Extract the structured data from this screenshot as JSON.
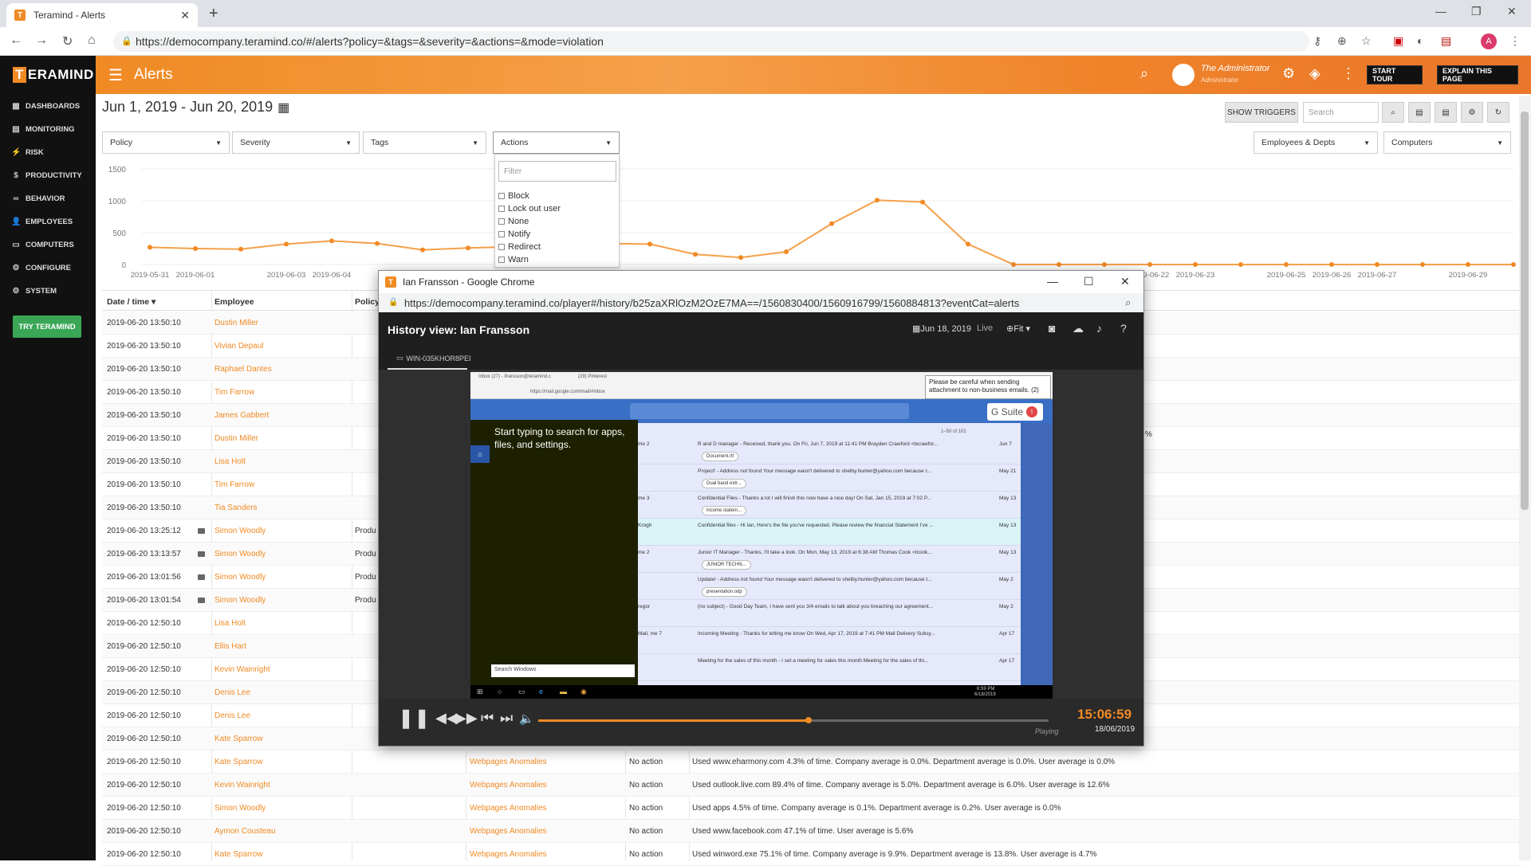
{
  "browser": {
    "tab_title": "Teramind - Alerts",
    "tab_favicon": "T",
    "url": "https://democompany.teramind.co/#/alerts?policy=&tags=&severity=&actions=&mode=violation",
    "profile_initial": "A"
  },
  "sidebar": {
    "logo_letter": "T",
    "logo_rest": "ERAMIND",
    "items": [
      {
        "label": "DASHBOARDS",
        "icon": "dashboard-icon"
      },
      {
        "label": "MONITORING",
        "icon": "monitor-icon"
      },
      {
        "label": "RISK",
        "icon": "risk-icon"
      },
      {
        "label": "PRODUCTIVITY",
        "icon": "dollar-icon"
      },
      {
        "label": "BEHAVIOR",
        "icon": "behavior-icon"
      },
      {
        "label": "EMPLOYEES",
        "icon": "employee-icon"
      },
      {
        "label": "COMPUTERS",
        "icon": "computer-icon"
      },
      {
        "label": "CONFIGURE",
        "icon": "gear-icon"
      },
      {
        "label": "SYSTEM",
        "icon": "system-icon"
      }
    ],
    "try_button": "TRY TERAMIND"
  },
  "topbar": {
    "title": "Alerts",
    "user_name": "The Administrator",
    "user_role": "Administrator",
    "start_tour": "START TOUR",
    "explain": "EXPLAIN THIS PAGE"
  },
  "controls": {
    "date_range": "Jun 1, 2019 - Jun 20, 2019",
    "show_triggers": "SHOW TRIGGERS",
    "search_placeholder": "Search",
    "filters": [
      "Policy",
      "Severity",
      "Tags",
      "Actions"
    ],
    "right_filters": [
      "Employees & Depts",
      "Computers"
    ]
  },
  "actions_dropdown": {
    "filter_placeholder": "Filter",
    "options": [
      "Block",
      "Lock out user",
      "None",
      "Notify",
      "Redirect",
      "Warn"
    ]
  },
  "chart_data": {
    "type": "line",
    "x": [
      "2019-05-31",
      "2019-06-01",
      "2019-06-02",
      "2019-06-03",
      "2019-06-04",
      "2019-06-05",
      "2019-06-06",
      "2019-06-07",
      "2019-06-08",
      "2019-06-09",
      "2019-06-10",
      "2019-06-11",
      "2019-06-12",
      "2019-06-13",
      "2019-06-14",
      "2019-06-15",
      "2019-06-16",
      "2019-06-17",
      "2019-06-18",
      "2019-06-19",
      "2019-06-20",
      "2019-06-21",
      "2019-06-22",
      "2019-06-23",
      "2019-06-24",
      "2019-06-25",
      "2019-06-26",
      "2019-06-27",
      "2019-06-28",
      "2019-06-29",
      "2019-06-30"
    ],
    "values": [
      270,
      250,
      240,
      320,
      370,
      330,
      230,
      260,
      280,
      300,
      330,
      320,
      160,
      110,
      200,
      640,
      1010,
      980,
      320,
      0,
      0,
      0,
      0,
      0,
      0,
      0,
      0,
      0,
      0,
      0,
      0
    ],
    "x_tick_labels": [
      "2019-05-31",
      "2019-06-01",
      "2019-06-03",
      "2019-06-04",
      "2019-06-22",
      "2019-06-23",
      "2019-06-25",
      "2019-06-26",
      "2019-06-27",
      "2019-06-29"
    ],
    "y_ticks": [
      "1500",
      "1000",
      "500",
      "0"
    ],
    "ylim": [
      0,
      1500
    ]
  },
  "table": {
    "headers": [
      "Date / time",
      "Employee",
      "Policy"
    ],
    "rows": [
      {
        "time": "2019-06-20 13:50:10",
        "employee": "Dustin Miller",
        "policy": "",
        "rule": "",
        "action": "",
        "detail": "",
        "cam": false
      },
      {
        "time": "2019-06-20 13:50:10",
        "employee": "Vivian Depaul",
        "policy": "",
        "rule": "",
        "action": "",
        "detail": "",
        "cam": false
      },
      {
        "time": "2019-06-20 13:50:10",
        "employee": "Raphael Dantes",
        "policy": "",
        "rule": "",
        "action": "",
        "detail": "",
        "cam": false
      },
      {
        "time": "2019-06-20 13:50:10",
        "employee": "Tim Farrow",
        "policy": "",
        "rule": "",
        "action": "",
        "detail": "",
        "cam": false
      },
      {
        "time": "2019-06-20 13:50:10",
        "employee": "James Gabbert",
        "policy": "",
        "rule": "",
        "action": "",
        "detail": "",
        "cam": false
      },
      {
        "time": "2019-06-20 13:50:10",
        "employee": "Dustin Miller",
        "policy": "",
        "rule": "",
        "action": "",
        "detail": "",
        "cam": false
      },
      {
        "time": "2019-06-20 13:50:10",
        "employee": "Lisa Holt",
        "policy": "",
        "rule": "",
        "action": "",
        "detail": "",
        "cam": false
      },
      {
        "time": "2019-06-20 13:50:10",
        "employee": "Tim Farrow",
        "policy": "",
        "rule": "",
        "action": "",
        "detail": "",
        "cam": false
      },
      {
        "time": "2019-06-20 13:50:10",
        "employee": "Tia Sanders",
        "policy": "",
        "rule": "",
        "action": "",
        "detail": "",
        "cam": false
      },
      {
        "time": "2019-06-20 13:25:12",
        "employee": "Simon Woodly",
        "policy": "Produ",
        "rule": "",
        "action": "",
        "detail": "",
        "cam": true
      },
      {
        "time": "2019-06-20 13:13:57",
        "employee": "Simon Woodly",
        "policy": "Produ",
        "rule": "",
        "action": "",
        "detail": "",
        "cam": true
      },
      {
        "time": "2019-06-20 13:01:56",
        "employee": "Simon Woodly",
        "policy": "Produ",
        "rule": "",
        "action": "",
        "detail": "",
        "cam": true
      },
      {
        "time": "2019-06-20 13:01:54",
        "employee": "Simon Woodly",
        "policy": "Produ",
        "rule": "",
        "action": "",
        "detail": "",
        "cam": true
      },
      {
        "time": "2019-06-20 12:50:10",
        "employee": "Lisa Holt",
        "policy": "",
        "rule": "",
        "action": "",
        "detail": "",
        "cam": false
      },
      {
        "time": "2019-06-20 12:50:10",
        "employee": "Ellis Hart",
        "policy": "",
        "rule": "",
        "action": "",
        "detail": "",
        "cam": false
      },
      {
        "time": "2019-06-20 12:50:10",
        "employee": "Kevin Wainright",
        "policy": "",
        "rule": "",
        "action": "",
        "detail": "",
        "cam": false
      },
      {
        "time": "2019-06-20 12:50:10",
        "employee": "Denis Lee",
        "policy": "",
        "rule": "",
        "action": "",
        "detail": "",
        "cam": false
      },
      {
        "time": "2019-06-20 12:50:10",
        "employee": "Denis Lee",
        "policy": "",
        "rule": "",
        "action": "",
        "detail": "",
        "cam": false
      },
      {
        "time": "2019-06-20 12:50:10",
        "employee": "Kate Sparrow",
        "policy": "",
        "rule": "",
        "action": "",
        "detail": "",
        "cam": false
      },
      {
        "time": "2019-06-20 12:50:10",
        "employee": "Kate Sparrow",
        "policy": "",
        "rule": "Webpages Anomalies",
        "action": "No action",
        "detail": "Used www.eharmony.com 4.3% of time. Company average is 0.0%. Department average is 0.0%. User average is 0.0%",
        "cam": false
      },
      {
        "time": "2019-06-20 12:50:10",
        "employee": "Kevin Wainright",
        "policy": "",
        "rule": "Webpages Anomalies",
        "action": "No action",
        "detail": "Used outlook.live.com 89.4% of time. Company average is 5.0%. Department average is 6.0%. User average is 12.6%",
        "cam": false
      },
      {
        "time": "2019-06-20 12:50:10",
        "employee": "Simon Woodly",
        "policy": "",
        "rule": "Webpages Anomalies",
        "action": "No action",
        "detail": "Used apps 4.5% of time. Company average is 0.1%. Department average is 0.2%. User average is 0.0%",
        "cam": false
      },
      {
        "time": "2019-06-20 12:50:10",
        "employee": "Aymon Cousteau",
        "policy": "",
        "rule": "Webpages Anomalies",
        "action": "No action",
        "detail": "Used www.facebook.com 47.1% of time. User average is 5.6%",
        "cam": false
      },
      {
        "time": "2019-06-20 12:50:10",
        "employee": "Kate Sparrow",
        "policy": "",
        "rule": "Webpages Anomalies",
        "action": "No action",
        "detail": "Used winword.exe 75.1% of time. Company average is 9.9%. Department average is 13.8%. User average is 4.7%",
        "cam": false
      }
    ],
    "partial_value": "%"
  },
  "popup": {
    "window_title": "Ian Fransson - Google Chrome",
    "url": "https://democompany.teramind.co/player#/history/b25zaXRlOzM2OzE7MA==/1560830400/1560916799/1560884813?eventCat=alerts",
    "history_title": "History view: Ian Fransson",
    "date": "Jun 18, 2019",
    "live": "Live",
    "fit": "Fit",
    "computer_tab": "WIN-035KHOR8PEI",
    "playback_status": "Playing",
    "time": "15:06:59",
    "playback_date": "18/06/2019",
    "progress": 0.53
  },
  "screen": {
    "tab1": "Inbox (27) - ifransson@teramind.c",
    "tab2": "(29) Pinterest",
    "url": "https://mail.google.com/mail/#inbox",
    "tooltip": "Please be careful when sending attachment to non-business emails. (2)",
    "suite": "G Suite",
    "suite_badge": "!",
    "counter": "1–50 of 101",
    "start_text": "Start typing to search for apps, files, and settings.",
    "search_windows": "Search Windows",
    "tray_time": "6:59 PM",
    "tray_date": "6/18/2019",
    "emails": [
      {
        "sender": "me 2",
        "subject": "R and D manager - Received, thank you. On Fri, Jun 7, 2019 at 11:41 PM Brayden Crawford <bcrawfor...",
        "date": "Jun 7",
        "attach": "Document.rtf"
      },
      {
        "sender": "",
        "subject": "Project! - Address not found Your message wasn't delivered to shelby.hunter@yahoo.com because t...",
        "date": "May 21",
        "attach": "Dual band extr..."
      },
      {
        "sender": "me 3",
        "subject": "Confidential Files - Thanks a lot I will finish this now have a nice day! On Sat, Jan 15, 2019 at 7:02 P...",
        "date": "May 13",
        "attach": "income statem..."
      },
      {
        "sender": "Krogh",
        "subject": "Confidential files - Hi Ian, Here's the file you've requested. Please review the financial Statement I've ...",
        "date": "May 13",
        "attach": ""
      },
      {
        "sender": "me 2",
        "subject": "Junior IT Manager - Thanks, I'll take a look. On Mon, May 13, 2019 at 6:38 AM Thomas Cook <tcook...",
        "date": "May 13",
        "attach": "JUNIOR TECHN..."
      },
      {
        "sender": "",
        "subject": "Update! - Address not found Your message wasn't delivered to shelby.hunter@yahoo.com because t...",
        "date": "May 2",
        "attach": "presentation.odp"
      },
      {
        "sender": "regor",
        "subject": "(no subject) - Good Day Team, I have sent you 3/4 emails to talk about you breaching our agreement...",
        "date": "May 2",
        "attach": ""
      },
      {
        "sender": "Mail, me 7",
        "subject": "Incoming Meeting - Thanks for letting me know On Wed, Apr 17, 2019 at 7:41 PM Mail Delivery Subsy...",
        "date": "Apr 17",
        "attach": ""
      },
      {
        "sender": "",
        "subject": "Meeting for the sales of this month - I set a meeting for sales this month Meeting for the sales of thi...",
        "date": "Apr 17",
        "attach": ""
      }
    ]
  }
}
